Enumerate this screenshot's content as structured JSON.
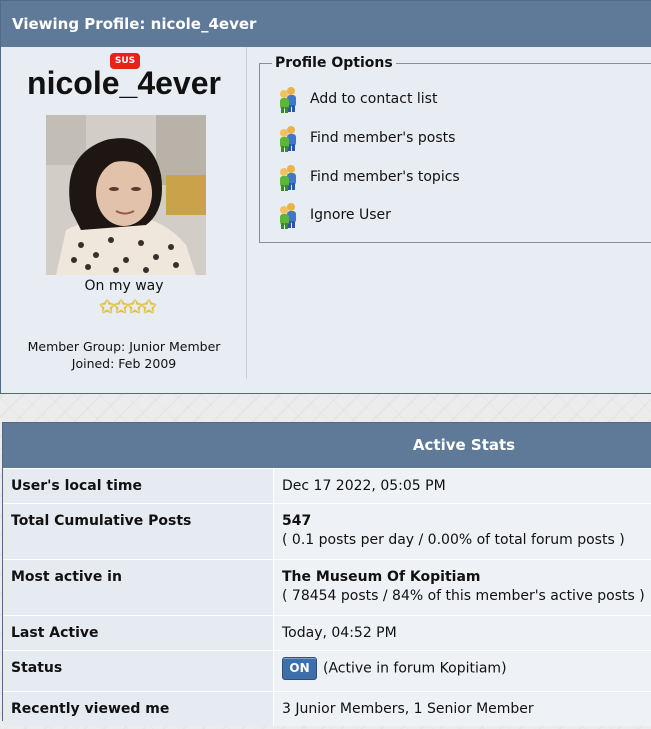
{
  "profile": {
    "header_title": "Viewing Profile: nicole_4ever",
    "username": "nicole_4ever",
    "badge": "SUS",
    "user_title": "On my way",
    "rating": {
      "stars": 4,
      "max": 4
    },
    "member_group": "Member Group: Junior Member",
    "joined": "Joined: Feb 2009"
  },
  "options": {
    "legend": "Profile Options",
    "items": [
      {
        "label": "Add to contact list",
        "icon": "users-icon"
      },
      {
        "label": "Find member's posts",
        "icon": "users-icon"
      },
      {
        "label": "Find member's topics",
        "icon": "users-icon"
      },
      {
        "label": "Ignore User",
        "icon": "users-icon"
      }
    ]
  },
  "stats": {
    "title": "Active Stats",
    "rows": [
      {
        "label": "User's local time",
        "value": "Dec 17 2022, 05:05 PM"
      },
      {
        "label": "Total Cumulative Posts",
        "value": "547",
        "sub": "( 0.1 posts per day / 0.00% of total forum posts )"
      },
      {
        "label": "Most active in",
        "value": "The Museum Of Kopitiam",
        "sub": "( 78454 posts / 84% of this member's active posts )"
      },
      {
        "label": "Last Active",
        "value": "Today, 04:52 PM"
      },
      {
        "label": "Status",
        "badge": "ON",
        "value": "(Active in forum Kopitiam)"
      },
      {
        "label": "Recently viewed me",
        "value": "3 Junior Members, 1 Senior Member"
      }
    ]
  },
  "colors": {
    "header_bg": "#5f7a98",
    "badge_red": "#e8211b",
    "status_on": "#3f6fa8",
    "star": "#f2c200"
  }
}
